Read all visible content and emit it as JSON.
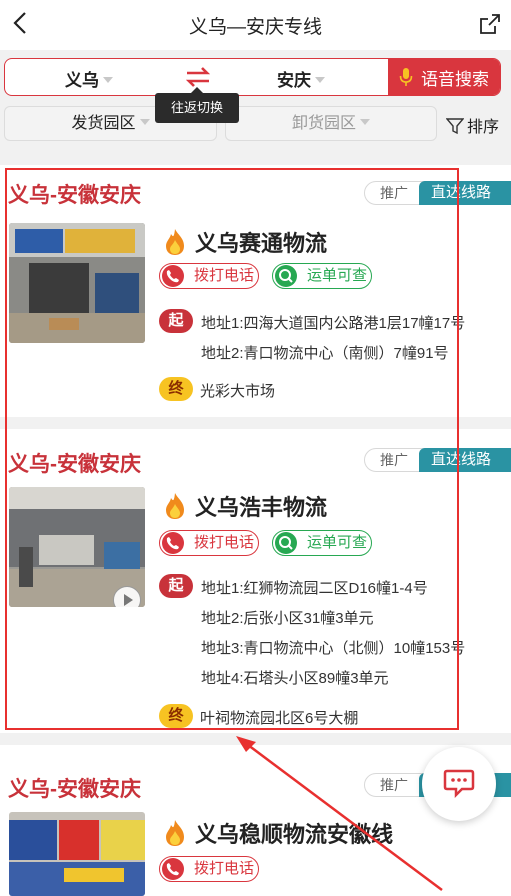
{
  "header": {
    "title": "义乌—安庆专线",
    "back_icon": "chevron-left-icon",
    "share_icon": "share-icon"
  },
  "search": {
    "from": "义乌",
    "to": "安庆",
    "swap_icon": "swap-icon",
    "voice_label": "语音搜索",
    "tooltip": "往返切换",
    "accent": "#d9363e"
  },
  "filters": {
    "send_park": "发货园区",
    "recv_park": "卸货园区",
    "sort_label": "排序"
  },
  "cards": [
    {
      "route": "义乌-安徽安庆",
      "promo": "推广",
      "direct": "直达线路",
      "company": "义乌赛通物流",
      "call": "拨打电话",
      "track": "运单可查",
      "start_tag": "起",
      "addresses": [
        "地址1:四海大道国内公路港1层17幢17号",
        "地址2:青口物流中心（南侧）7幢91号"
      ],
      "end_tag": "终",
      "destination": "光彩大市场"
    },
    {
      "route": "义乌-安徽安庆",
      "promo": "推广",
      "direct": "直达线路",
      "company": "义乌浩丰物流",
      "call": "拨打电话",
      "track": "运单可查",
      "start_tag": "起",
      "addresses": [
        "地址1:红狮物流园二区D16幢1-4号",
        "地址2:后张小区31幢3单元",
        "地址3:青口物流中心（北侧）10幢153号",
        "地址4:石塔头小区89幢3单元"
      ],
      "end_tag": "终",
      "destination": "叶祠物流园北区6号大棚"
    },
    {
      "route": "义乌-安徽安庆",
      "promo": "推广",
      "direct": "直达线路",
      "company": "义乌稳顺物流安徽线",
      "call": "拨打电话"
    }
  ],
  "colors": {
    "route_red": "#c8323a",
    "direct_teal": "#2a93a3",
    "track_green": "#27a852",
    "end_yellow": "#f7c322"
  }
}
